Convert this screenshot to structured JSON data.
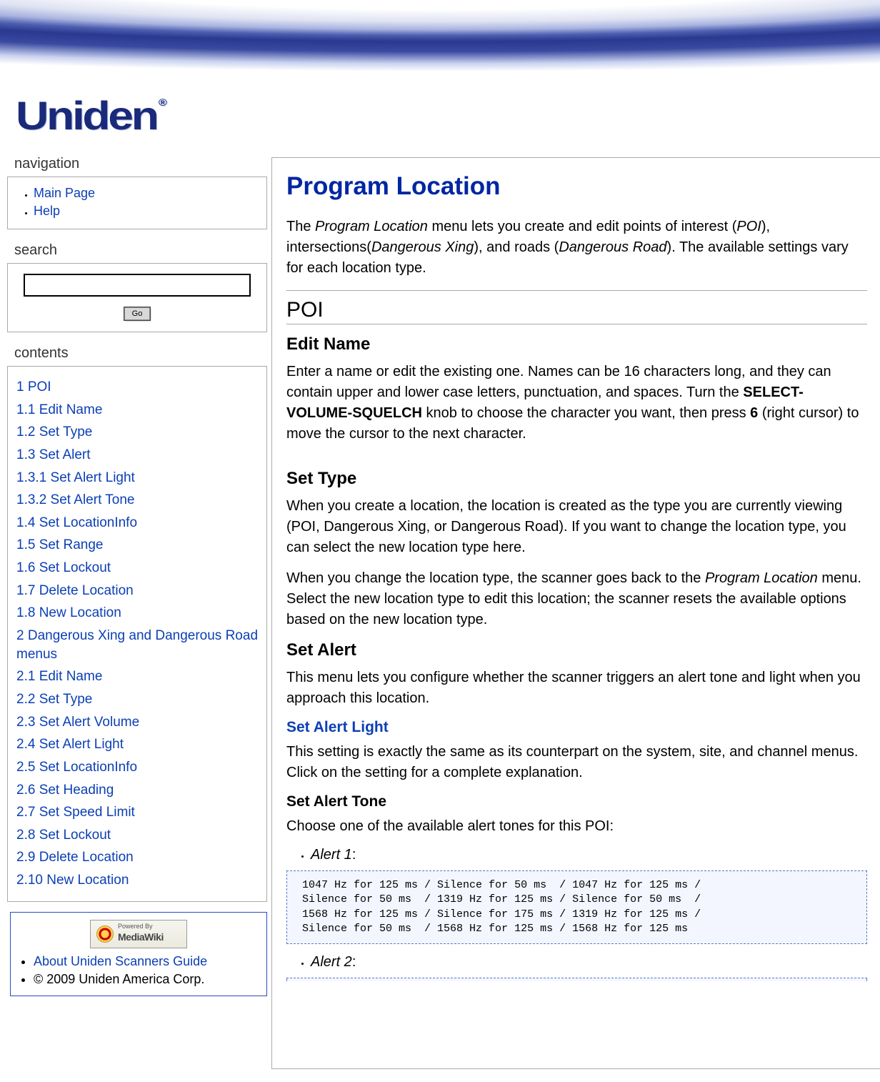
{
  "brand": "Uniden",
  "sidebar": {
    "nav_title": "navigation",
    "nav_items": [
      {
        "label": "Main Page"
      },
      {
        "label": "Help"
      }
    ],
    "search_title": "search",
    "search_value": "",
    "go_label": "Go",
    "contents_title": "contents",
    "toc": [
      "1 POI",
      "1.1 Edit Name",
      "1.2 Set Type",
      "1.3 Set Alert",
      "1.3.1 Set Alert Light",
      "1.3.2 Set Alert Tone",
      "1.4 Set LocationInfo",
      "1.5 Set Range",
      "1.6 Set Lockout",
      "1.7 Delete Location",
      "1.8 New Location",
      "2 Dangerous Xing and Dangerous Road menus",
      "2.1 Edit Name",
      "2.2 Set Type",
      "2.3 Set Alert Volume",
      "2.4 Set Alert Light",
      "2.5 Set LocationInfo",
      "2.6 Set Heading",
      "2.7 Set Speed Limit",
      "2.8 Set Lockout",
      "2.9 Delete Location",
      "2.10 New Location"
    ],
    "mw_top": "Powered By",
    "mw_bottom": "MediaWiki",
    "about_link": "About Uniden Scanners Guide",
    "copyright": "© 2009 Uniden America Corp."
  },
  "main": {
    "title": "Program Location",
    "intro_1a": "The ",
    "intro_1b": "Program Location",
    "intro_1c": " menu lets you create and edit points of interest (",
    "intro_1d": "POI",
    "intro_1e": "), intersections(",
    "intro_1f": "Dangerous Xing",
    "intro_1g": "), and roads (",
    "intro_1h": "Dangerous Road",
    "intro_1i": "). The available settings vary for each location type.",
    "h2_poi": "POI",
    "h3_edit_name": "Edit Name",
    "edit_name_a": "Enter a name or edit the existing one. Names can be 16 characters long, and they can contain upper and lower case letters, punctuation, and spaces. Turn the ",
    "edit_name_b": "SELECT-VOLUME-SQUELCH",
    "edit_name_c": " knob to choose the character you want, then press ",
    "edit_name_d": "6",
    "edit_name_e": " (right cursor) to move the cursor to the next character.",
    "h3_set_type": "Set Type",
    "set_type_p1": "When you create a location, the location is created as the type you are currently viewing (POI, Dangerous Xing, or Dangerous Road). If you want to change the location type, you can select the new location type here.",
    "set_type_p2a": "When you change the location type, the scanner goes back to the ",
    "set_type_p2b": "Program Location",
    "set_type_p2c": " menu. Select the new location type to edit this location; the scanner resets the available options based on the new location type.",
    "h3_set_alert": "Set Alert",
    "set_alert_p": "This menu lets you configure whether the scanner triggers an alert tone and light when you approach this location.",
    "h4_set_alert_light": "Set Alert Light",
    "set_alert_light_p": "This setting is exactly the same as its counterpart on the system, site, and channel menus. Click on the setting for a complete explanation.",
    "h4_set_alert_tone": "Set Alert Tone",
    "set_alert_tone_p": "Choose one of the available alert tones for this POI:",
    "alert1_label": "Alert 1",
    "alert1_seq": " 1047 Hz for 125 ms / Silence for 50 ms  / 1047 Hz for 125 ms / \n Silence for 50 ms  / 1319 Hz for 125 ms / Silence for 50 ms  / \n 1568 Hz for 125 ms / Silence for 175 ms / 1319 Hz for 125 ms / \n Silence for 50 ms  / 1568 Hz for 125 ms / 1568 Hz for 125 ms",
    "alert2_label": "Alert 2",
    "colon": ":"
  }
}
